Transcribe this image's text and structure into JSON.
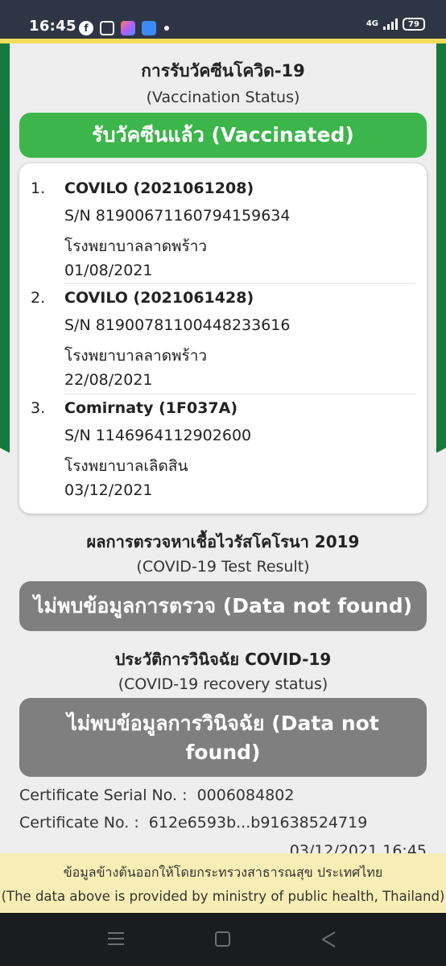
{
  "status_bar": {
    "time": "16:45",
    "network": "4G",
    "battery": "79",
    "notification_icons": [
      "facebook-icon",
      "copy-icon",
      "shortcut-app-icon",
      "wallet-icon",
      "notification-dot"
    ]
  },
  "vaccination": {
    "title_th": "การรับวัคซีนโควิด-19",
    "title_en": "(Vaccination Status)",
    "status": "รับวัคซีนแล้ว (Vaccinated)",
    "doses": [
      {
        "number": "1.",
        "name": "COVILO (2021061208)",
        "serial": "S/N 81900671160794159634",
        "hospital": "โรงพยาบาลลาดพร้าว",
        "date": "01/08/2021"
      },
      {
        "number": "2.",
        "name": "COVILO (2021061428)",
        "serial": "S/N 81900781100448233616",
        "hospital": "โรงพยาบาลลาดพร้าว",
        "date": "22/08/2021"
      },
      {
        "number": "3.",
        "name": "Comirnaty (1F037A)",
        "serial": "S/N 1146964112902600",
        "hospital": "โรงพยาบาลเลิดสิน",
        "date": "03/12/2021"
      }
    ]
  },
  "test_result": {
    "title_th": "ผลการตรวจหาเชื้อไวรัสโคโรนา 2019",
    "title_en": "(COVID-19 Test Result)",
    "status": "ไม่พบข้อมูลการตรวจ (Data not found)"
  },
  "recovery": {
    "title_th": "ประวัติการวินิจฉัย COVID-19",
    "title_en": "(COVID-19 recovery status)",
    "status_line1": "ไม่พบข้อมูลการวินิจฉัย (Data not",
    "status_line2": "found)"
  },
  "certificate": {
    "serial_label": "Certificate Serial No. :",
    "serial_value": "0006084802",
    "number_label": "Certificate No. :",
    "number_value": "612e6593b...b91638524719",
    "issued": "03/12/2021 16:45"
  },
  "footer": {
    "text_th": "ข้อมูลข้างต้นออกให้โดยกระทรวงสาธารณสุข ประเทศไทย",
    "text_en": "(The data above is provided by ministry of public health, Thailand)"
  },
  "colors": {
    "vaccinated": "#3cb54b",
    "not_found": "#7f7f7f",
    "band": "#167a3a",
    "footer_bg": "#f8eeb5"
  }
}
